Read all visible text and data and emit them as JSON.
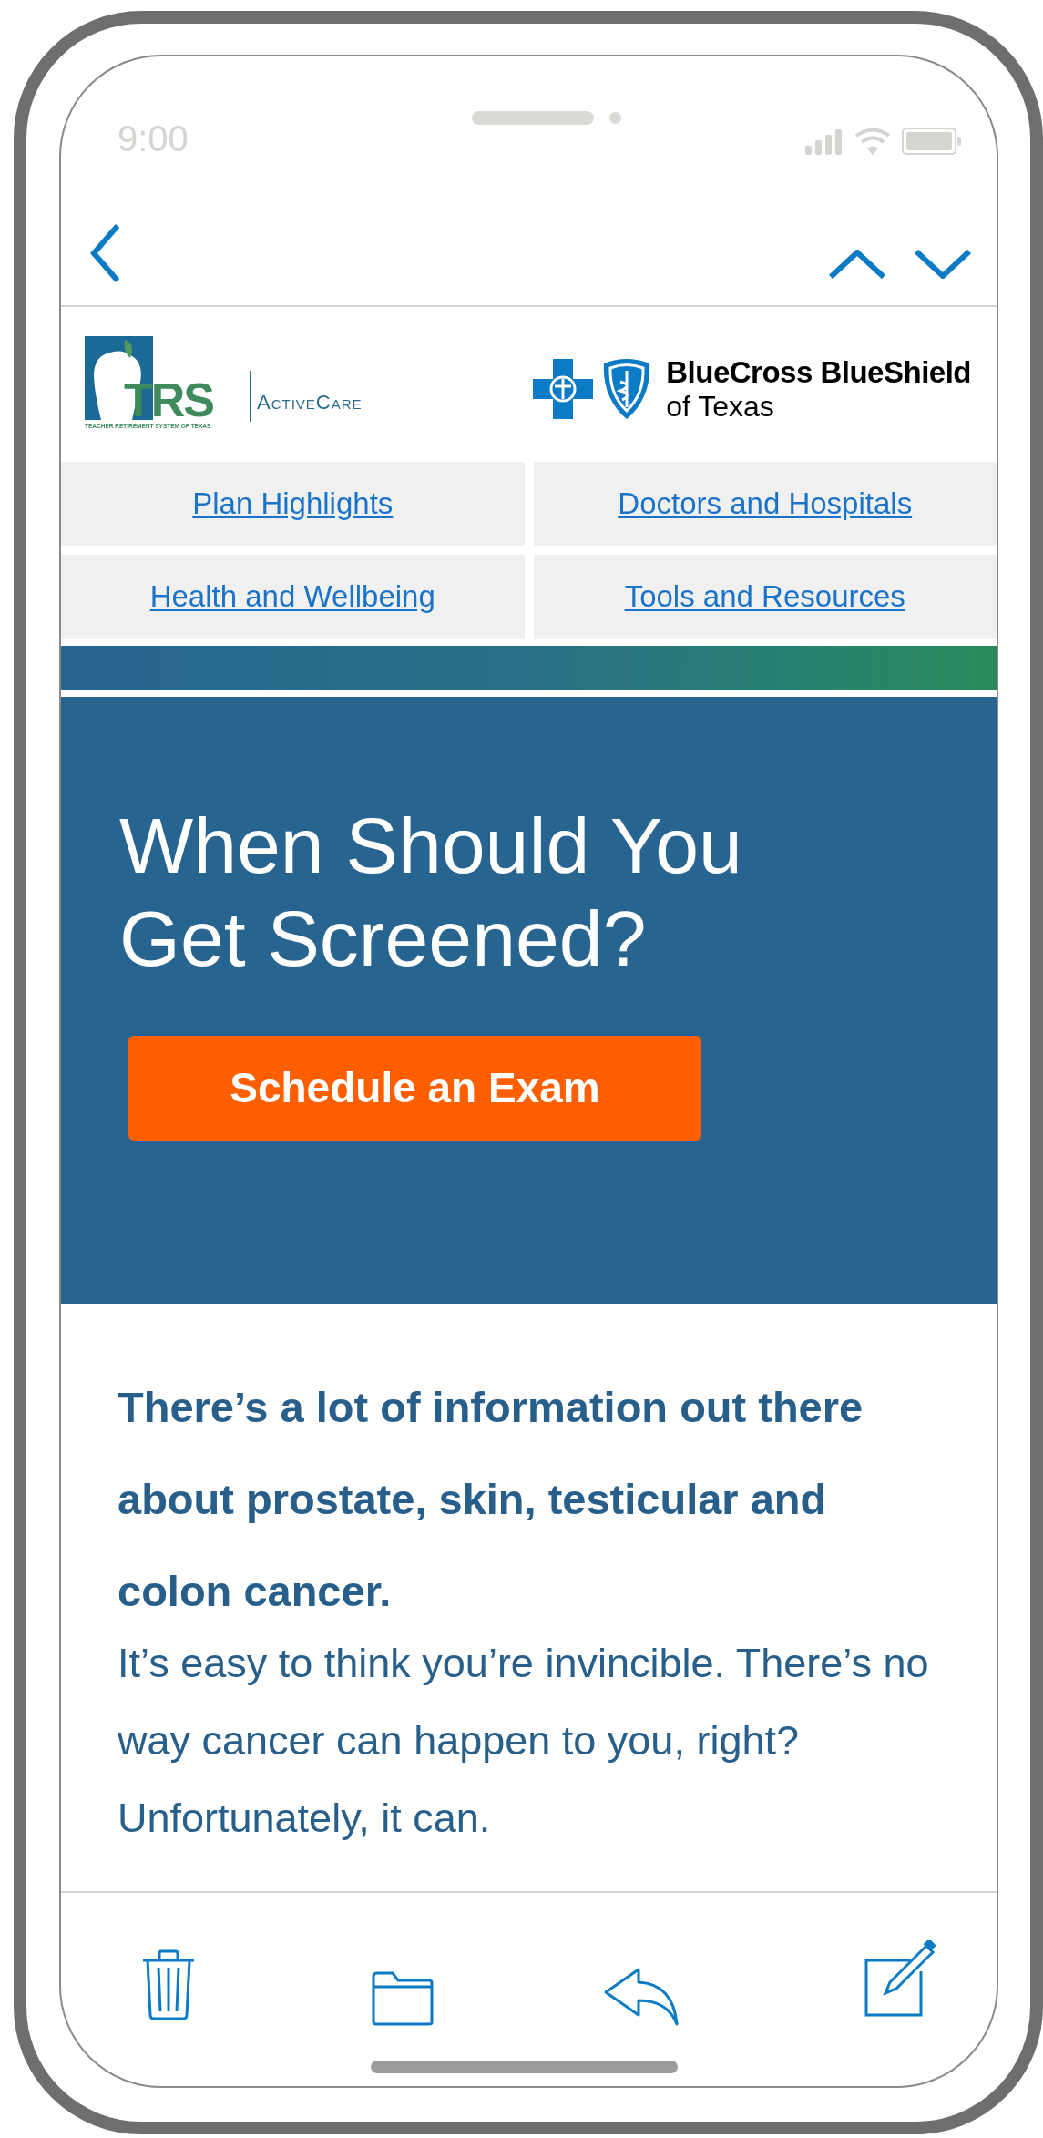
{
  "status_bar": {
    "time": "9:00"
  },
  "email": {
    "logos": {
      "trs": {
        "mark": "TRS",
        "subtitle": "TEACHER RETIREMENT SYSTEM OF TEXAS",
        "product": "ActiveCare"
      },
      "bcbs": {
        "name": "BlueCross BlueShield",
        "region": "of Texas"
      }
    },
    "nav_links": [
      "Plan Highlights",
      "Doctors and Hospitals",
      "Health and Wellbeing",
      "Tools and Resources"
    ],
    "hero": {
      "title": "When Should You Get Screened?",
      "button": "Schedule an Exam"
    },
    "body": {
      "heading": "There’s a lot of information out there about prostate, skin, testicular and colon cancer.",
      "paragraph": "It’s easy to think you’re invincible. There’s no way cancer can happen to you, right? Unfortunately, it can."
    }
  }
}
